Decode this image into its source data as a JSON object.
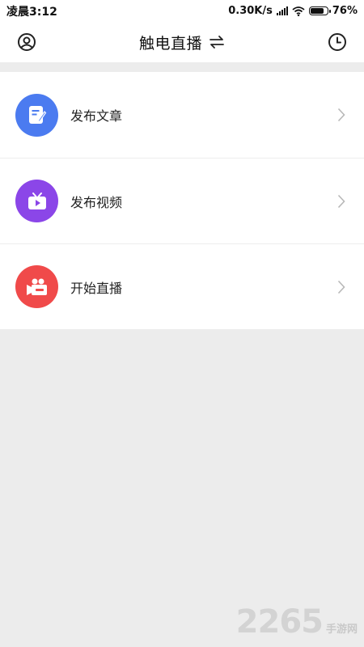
{
  "status_bar": {
    "time": "凌晨3:12",
    "net_speed": "0.30K/s",
    "battery": "76%"
  },
  "header": {
    "title": "触电直播",
    "left_icon": "user-icon",
    "right_icon": "clock-icon",
    "swap_icon": "swap-icon"
  },
  "menu": {
    "items": [
      {
        "label": "发布文章",
        "icon": "article-edit-icon",
        "color": "#4b7bf0"
      },
      {
        "label": "发布视频",
        "icon": "tv-play-icon",
        "color": "#8b46e8"
      },
      {
        "label": "开始直播",
        "icon": "video-camera-icon",
        "color": "#f04a4a"
      }
    ]
  },
  "watermark": {
    "number": "2265",
    "text": "手游网"
  }
}
